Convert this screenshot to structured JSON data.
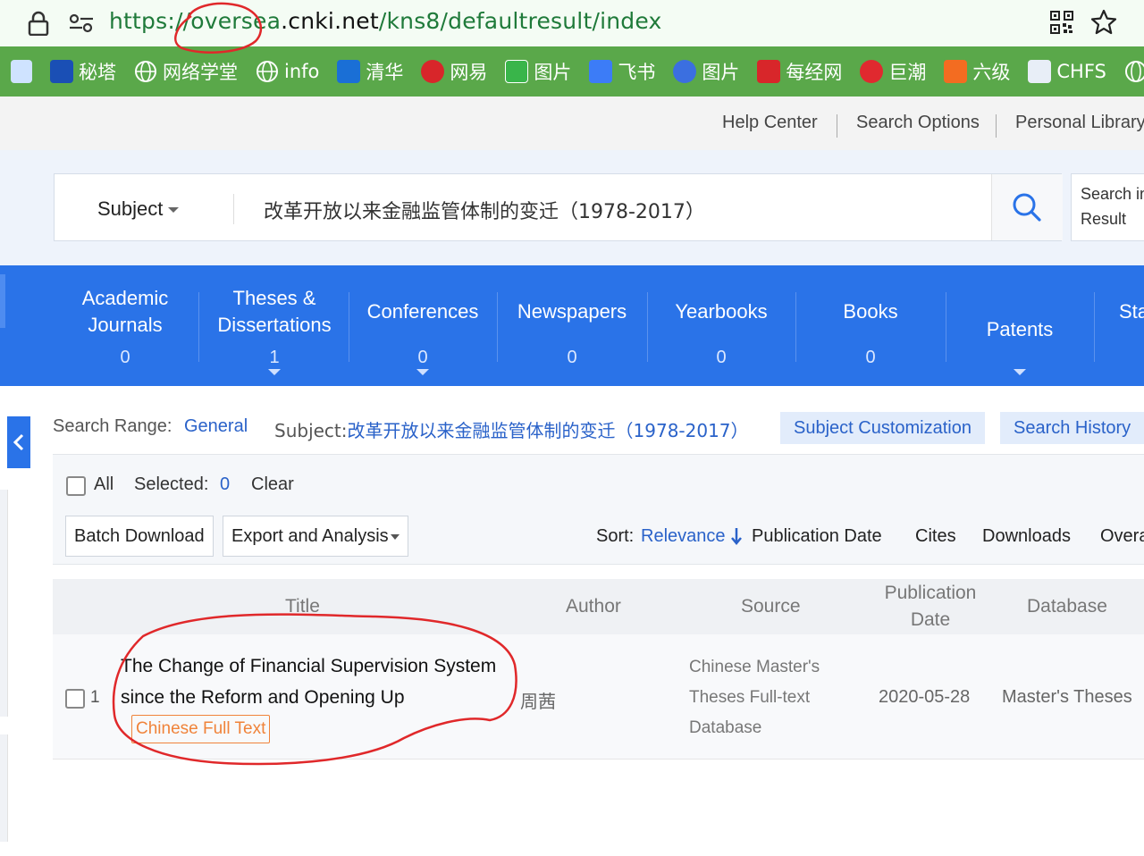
{
  "browser": {
    "url_scheme": "https://",
    "url_highlight": "oversea",
    "url_host": ".cnki.net",
    "url_path": "/kns8/defaultresult/index"
  },
  "bookmarks": [
    {
      "label": "秘塔",
      "icon": "mita-icon",
      "color": "#1a4fb5"
    },
    {
      "label": "网络学堂",
      "icon": "globe-icon",
      "color": "#ffffff"
    },
    {
      "label": "info",
      "icon": "globe-icon",
      "color": "#ffffff"
    },
    {
      "label": "清华",
      "icon": "c-logo-icon",
      "color": "#1a6fd6"
    },
    {
      "label": "网易",
      "icon": "netease-icon",
      "color": "#d8262a"
    },
    {
      "label": "图片",
      "icon": "px-icon",
      "color": "#39b54a"
    },
    {
      "label": "飞书",
      "icon": "feishu-icon",
      "color": "#3c7cf7"
    },
    {
      "label": "图片",
      "icon": "baidu-paw-icon",
      "color": "#3b6fe0"
    },
    {
      "label": "每经网",
      "icon": "nbd-icon",
      "color": "#d8262a"
    },
    {
      "label": "巨潮",
      "icon": "cninfo-icon",
      "color": "#e0292f"
    },
    {
      "label": "六级",
      "icon": "cet-icon",
      "color": "#f36c21"
    },
    {
      "label": "CHFS",
      "icon": "chfs-icon",
      "color": "#e8eef7"
    }
  ],
  "toplinks": {
    "help": "Help Center",
    "options": "Search Options",
    "library": "Personal Library"
  },
  "search": {
    "field": "Subject",
    "query": "改革开放以来金融监管体制的变迁（1978-2017）",
    "search_in_line1": "Search in",
    "search_in_line2": "Result"
  },
  "databases": [
    {
      "line1": "Academic",
      "line2": "Journals",
      "count": "0"
    },
    {
      "line1": "Theses &",
      "line2": "Dissertations",
      "count": "1"
    },
    {
      "line1": "Conferences",
      "line2": "",
      "count": "0"
    },
    {
      "line1": "Newspapers",
      "line2": "",
      "count": "0"
    },
    {
      "line1": "Yearbooks",
      "line2": "",
      "count": "0"
    },
    {
      "line1": "Books",
      "line2": "",
      "count": "0"
    },
    {
      "line1": "Patents",
      "line2": "",
      "count": ""
    },
    {
      "line1": "Sta",
      "line2": "",
      "count": ""
    }
  ],
  "range": {
    "label": "Search Range:",
    "value": "General",
    "subject_label": "Subject:",
    "subject_value": "改革开放以来金融监管体制的变迁（1978-2017）",
    "customization": "Subject Customization",
    "history": "Search History"
  },
  "toolbar": {
    "all": "All",
    "selected_label": "Selected:",
    "selected_count": "0",
    "clear": "Clear",
    "batch_download": "Batch Download",
    "export": "Export and Analysis",
    "sort_label": "Sort:",
    "sort_options": [
      "Relevance",
      "Publication Date",
      "Cites",
      "Downloads",
      "Overa"
    ]
  },
  "table": {
    "headers": {
      "title": "Title",
      "author": "Author",
      "source": "Source",
      "date_line1": "Publication",
      "date_line2": "Date",
      "database": "Database"
    },
    "rows": [
      {
        "num": "1",
        "title": "The Change of Financial Supervision System since the Reform and Opening Up",
        "fulltext": "Chinese Full Text",
        "author": "周茜",
        "source_line1": "Chinese Master's",
        "source_line2": "Theses Full-text",
        "source_line3": "Database",
        "date": "2020-05-28",
        "database": "Master's Theses"
      }
    ]
  },
  "annotation_color": "#e0282a"
}
